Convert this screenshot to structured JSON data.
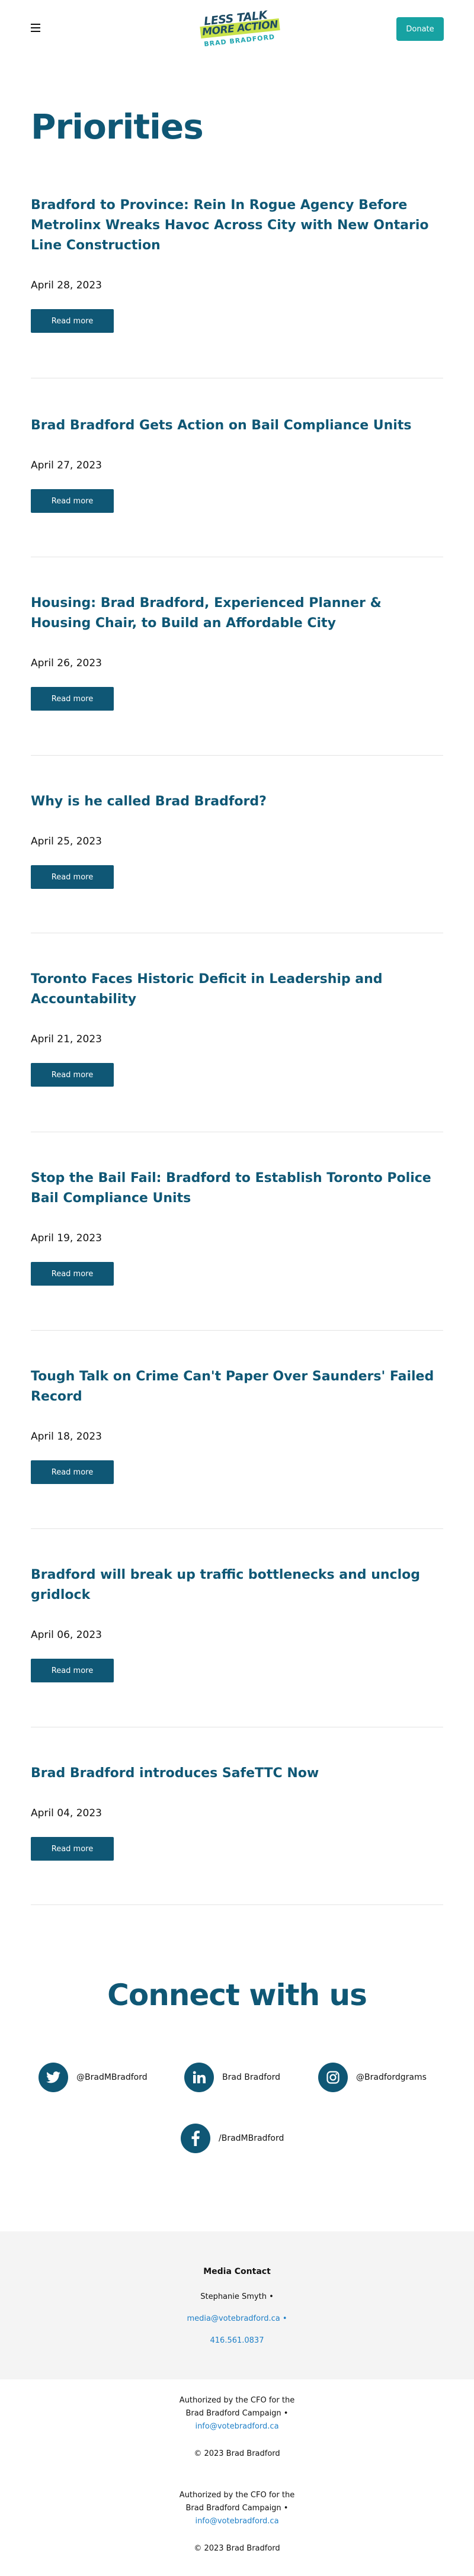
{
  "header": {
    "logo": {
      "line1": "LESS TALK",
      "line2": "MORE ACTION",
      "line3": "BRAD BRADFORD"
    },
    "donate_label": "Donate"
  },
  "page_title": "Priorities",
  "read_more_label": "Read more",
  "posts": [
    {
      "title": "Bradford to Province: Rein In Rogue Agency Before Metrolinx Wreaks Havoc Across City with New Ontario Line Construction",
      "date": "April 28, 2023"
    },
    {
      "title": "Brad Bradford Gets Action on Bail Compliance Units",
      "date": "April 27, 2023"
    },
    {
      "title": "Housing: Brad Bradford, Experienced Planner & Housing Chair, to Build an Affordable City",
      "date": "April 26, 2023"
    },
    {
      "title": "Why is he called Brad Bradford?",
      "date": "April 25, 2023"
    },
    {
      "title": "Toronto Faces Historic Deficit in Leadership and Accountability",
      "date": "April 21, 2023"
    },
    {
      "title": "Stop the Bail Fail: Bradford to Establish Toronto Police Bail Compliance Units",
      "date": "April 19, 2023"
    },
    {
      "title": "Tough Talk on Crime Can't Paper Over Saunders' Failed Record",
      "date": "April 18, 2023"
    },
    {
      "title": "Bradford will break up traffic bottlenecks and unclog gridlock",
      "date": "April 06, 2023"
    },
    {
      "title": "Brad Bradford introduces SafeTTC Now",
      "date": "April 04, 2023"
    }
  ],
  "connect": {
    "title": "Connect with us",
    "twitter": "@BradMBradford",
    "linkedin": "Brad Bradford",
    "instagram": "@Bradfordgrams",
    "facebook": "/BradMBradford"
  },
  "media_contact": {
    "title": "Media Contact",
    "name": "Stephanie Smyth •",
    "email": "media@votebradford.ca •",
    "phone": "416.561.0837"
  },
  "footer": {
    "auth1_line1": "Authorized by the CFO for the",
    "auth1_line2": "Brad Bradford Campaign •",
    "auth1_email": "info@votebradford.ca",
    "copyright1": "© 2023 Brad Bradford",
    "auth2_line1": "Authorized by the CFO for the",
    "auth2_line2": "Brad Bradford Campaign •",
    "auth2_email": "info@votebradford.ca",
    "copyright2": "© 2023 Brad Bradford"
  },
  "colors": {
    "brand_blue": "#0f5775",
    "donate_teal": "#17a2a2",
    "logo_lime": "#c8e24a",
    "link_blue": "#1e7fc7"
  }
}
